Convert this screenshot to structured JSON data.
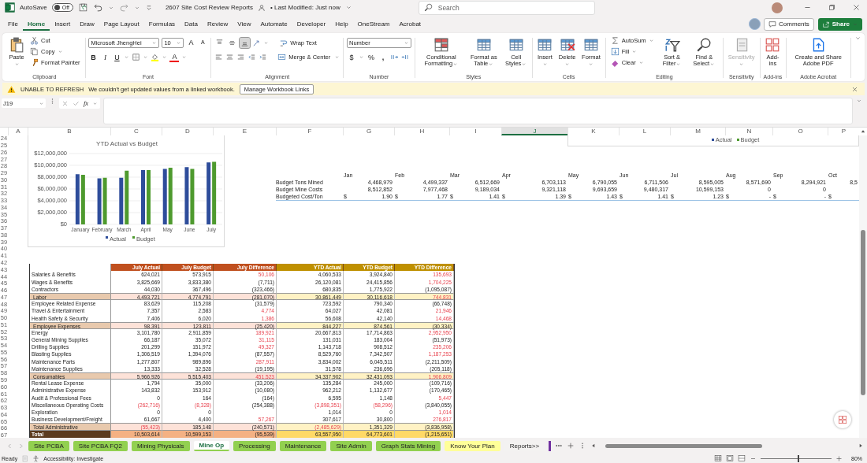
{
  "titlebar": {
    "autosave_label": "AutoSave",
    "autosave": {
      "on": false,
      "label": "Off"
    },
    "doc_title": "2607 Site Cost Review Reports",
    "modified": "• Last Modified: Just now",
    "search_placeholder": "Search"
  },
  "menu": [
    {
      "label": "File",
      "selected": false
    },
    {
      "label": "Home",
      "selected": true
    },
    {
      "label": "Insert",
      "selected": false
    },
    {
      "label": "Draw",
      "selected": false
    },
    {
      "label": "Page Layout",
      "selected": false
    },
    {
      "label": "Formulas",
      "selected": false
    },
    {
      "label": "Data",
      "selected": false
    },
    {
      "label": "Review",
      "selected": false
    },
    {
      "label": "View",
      "selected": false
    },
    {
      "label": "Automate",
      "selected": false
    },
    {
      "label": "Developer",
      "selected": false
    },
    {
      "label": "Help",
      "selected": false
    },
    {
      "label": "OneStream",
      "selected": false
    },
    {
      "label": "Acrobat",
      "selected": false
    }
  ],
  "actions": {
    "comments": "Comments",
    "share": "Share"
  },
  "ribbon": [
    {
      "kind": "standard",
      "label": "Clipboard",
      "items": [
        {
          "kind": "paste",
          "label": "Paste",
          "menu": true,
          "disabled": false
        },
        {
          "kind": "cut",
          "label": "Cut",
          "menu": false,
          "disabled": false
        },
        {
          "kind": "copy",
          "label": "Copy",
          "menu": true,
          "disabled": false
        },
        {
          "kind": "painter",
          "label": "Format Painter",
          "menu": false,
          "disabled": false
        }
      ]
    },
    {
      "kind": "font",
      "label": "Font",
      "font_name": "Microsoft JhengHei",
      "font_size": "10",
      "grow": "A",
      "shrink": "A",
      "bold": "B",
      "italic": "I",
      "underline": "U",
      "font_color": "A"
    },
    {
      "kind": "alignment",
      "label": "Alignment",
      "valign": [
        {
          "selected": false
        },
        {
          "selected": false
        },
        {
          "selected": true
        }
      ],
      "wrap": "Wrap Text",
      "merge": "Merge & Center"
    },
    {
      "kind": "number",
      "label": "Number",
      "format": "Number",
      "currency": "$",
      "percent": "%",
      "comma": ","
    },
    {
      "kind": "standard",
      "label": "Styles",
      "items": [
        {
          "kind": "cond_format",
          "label": "Conditional Formatting",
          "menu": true,
          "disabled": false
        },
        {
          "kind": "format_table",
          "label": "Format as Table",
          "menu": true,
          "disabled": false
        },
        {
          "kind": "cell_styles",
          "label": "Cell Styles",
          "menu": true,
          "disabled": false
        }
      ]
    },
    {
      "kind": "standard",
      "label": "Cells",
      "items": [
        {
          "kind": "insert",
          "label": "Insert",
          "menu": true,
          "disabled": false
        },
        {
          "kind": "delete",
          "label": "Delete",
          "menu": true,
          "disabled": false
        },
        {
          "kind": "format",
          "label": "Format",
          "menu": true,
          "disabled": false
        }
      ]
    },
    {
      "kind": "standard",
      "label": "Editing",
      "items": [
        {
          "kind": "autosum",
          "label": "AutoSum",
          "menu": true,
          "disabled": false
        },
        {
          "kind": "fill",
          "label": "Fill",
          "menu": true,
          "disabled": false
        },
        {
          "kind": "clear",
          "label": "Clear",
          "menu": true,
          "disabled": false
        },
        {
          "kind": "sort",
          "label": "Sort & Filter",
          "menu": true,
          "disabled": false
        },
        {
          "kind": "find",
          "label": "Find & Select",
          "menu": true,
          "disabled": false
        }
      ]
    },
    {
      "kind": "standard",
      "label": "Sensitivity",
      "items": [
        {
          "kind": "sensitivity",
          "label": "Sensitivity",
          "menu": true,
          "disabled": true
        }
      ]
    },
    {
      "kind": "standard",
      "label": "Add-ins",
      "items": [
        {
          "kind": "addins",
          "label": "Add-ins",
          "menu": false,
          "disabled": false
        }
      ]
    },
    {
      "kind": "standard",
      "label": "Adobe Acrobat",
      "items": [
        {
          "kind": "pdf",
          "label": "Create and Share Adobe PDF",
          "menu": false,
          "disabled": false
        }
      ]
    }
  ],
  "warning": {
    "title": "UNABLE TO REFRESH",
    "message": "We couldn't get updated values from a linked workbook.",
    "button": "Manage Workbook Links"
  },
  "formula_bar": {
    "cell_ref": "J19",
    "fx": "fx"
  },
  "columns": [
    {
      "label": "A",
      "selected": false
    },
    {
      "label": "B",
      "selected": false
    },
    {
      "label": "C",
      "selected": false
    },
    {
      "label": "D",
      "selected": false
    },
    {
      "label": "E",
      "selected": false
    },
    {
      "label": "F",
      "selected": false
    },
    {
      "label": "G",
      "selected": false
    },
    {
      "label": "H",
      "selected": false
    },
    {
      "label": "I",
      "selected": false
    },
    {
      "label": "J",
      "selected": true
    },
    {
      "label": "K",
      "selected": false
    },
    {
      "label": "L",
      "selected": false
    },
    {
      "label": "M",
      "selected": false
    },
    {
      "label": "N",
      "selected": false
    },
    {
      "label": "O",
      "selected": false
    },
    {
      "label": "P",
      "selected": false
    }
  ],
  "row_numbers": [
    "24",
    "25",
    "26",
    "27",
    "28",
    "29",
    "30",
    "31",
    "32",
    "33",
    "34",
    "35",
    "36",
    "37",
    "38",
    "39",
    "40",
    "41",
    "42",
    "43",
    "44",
    "45",
    "46",
    "47",
    "48",
    "49",
    "50",
    "51",
    "52",
    "53",
    "54",
    "55",
    "56",
    "57",
    "58",
    "59",
    "60",
    "61",
    "62",
    "63",
    "64",
    "65",
    "66",
    "67"
  ],
  "chart": {
    "chart_data": {
      "type": "bar",
      "title": "YTD Actual vs Budget",
      "categories": [
        "January",
        "February",
        "March",
        "April",
        "May",
        "June",
        "July"
      ],
      "series": [
        {
          "name": "Actual",
          "color": "#2e4d9b",
          "values": [
            8500000,
            7800000,
            7900000,
            9200000,
            9400000,
            9700000,
            10500000
          ]
        },
        {
          "name": "Budget",
          "color": "#4e9a2e",
          "values": [
            8400000,
            7900000,
            9100000,
            9200000,
            9600000,
            9400000,
            10600000
          ]
        }
      ],
      "ylim": [
        0,
        12000000
      ],
      "yticks": [
        {
          "value": 0,
          "label": "$0"
        },
        {
          "value": 2000000,
          "label": "$2,000,000"
        },
        {
          "value": 4000000,
          "label": "$4,000,000"
        },
        {
          "value": 6000000,
          "label": "$6,000,000"
        },
        {
          "value": 8000000,
          "label": "$8,000,000"
        },
        {
          "value": 10000000,
          "label": "$10,000,000"
        },
        {
          "value": 12000000,
          "label": "$12,000,000"
        }
      ],
      "grid": true,
      "legend": "bottom"
    }
  },
  "second_chart": {
    "legend": [
      {
        "label": "Actual",
        "color": "#2e4d9b"
      },
      {
        "label": "Budget",
        "color": "#4e9a2e"
      }
    ]
  },
  "budget_table": {
    "months": [
      "Jan",
      "Feb",
      "Mar",
      "Apr",
      "May",
      "Jun",
      "Jul",
      "Aug",
      "Sep",
      "Oct"
    ],
    "rows": [
      {
        "label": "Budget Tons Mined",
        "kind": "number",
        "values": [
          "4,468,979",
          "4,499,337",
          "6,512,669",
          "6,703,113",
          "6,790,055",
          "6,711,506",
          "8,595,005",
          "8,571,690",
          "8,294,921",
          "8,5"
        ]
      },
      {
        "label": "Budget Mine Costs",
        "kind": "number",
        "values": [
          "8,512,852",
          "7,977,468",
          "9,189,034",
          "9,321,118",
          "9,693,659",
          "9,480,317",
          "10,599,153",
          "0",
          "0"
        ]
      },
      {
        "label": "Budgeted Cost/Ton",
        "kind": "currency",
        "values": [
          {
            "sym": "$",
            "v": "1.90"
          },
          {
            "sym": "$",
            "v": "1.77"
          },
          {
            "sym": "$",
            "v": "1.41"
          },
          {
            "sym": "$",
            "v": "1.39"
          },
          {
            "sym": "$",
            "v": "1.43"
          },
          {
            "sym": "$",
            "v": "1.41"
          },
          {
            "sym": "$",
            "v": "1.23"
          },
          {
            "sym": "$",
            "v": "-"
          },
          {
            "sym": "$",
            "v": "-"
          },
          {
            "sym": "$"
          }
        ]
      }
    ]
  },
  "cost_table": {
    "columns": [
      {
        "label": "July Actual",
        "kind": "july"
      },
      {
        "label": "July Budget",
        "kind": "july"
      },
      {
        "label": "July Difference",
        "kind": "july"
      },
      {
        "label": "YTD Actual",
        "kind": "ytd"
      },
      {
        "label": "YTD Budget",
        "kind": "ytd"
      },
      {
        "label": "YTD Difference",
        "kind": "ytd"
      }
    ],
    "rows": [
      {
        "label": "Salaries & Benefits",
        "kind": "line",
        "cells": [
          {
            "v": "624,021",
            "red": false
          },
          {
            "v": "573,915",
            "red": false
          },
          {
            "v": "50,106",
            "red": true
          },
          {
            "v": "4,060,533",
            "red": false
          },
          {
            "v": "3,924,840",
            "red": false
          },
          {
            "v": "135,693",
            "red": true
          }
        ]
      },
      {
        "label": "Wages & Benefits",
        "kind": "line",
        "cells": [
          {
            "v": "3,825,669",
            "red": false
          },
          {
            "v": "3,833,380",
            "red": false
          },
          {
            "v": "(7,711)",
            "red": false
          },
          {
            "v": "26,120,081",
            "red": false
          },
          {
            "v": "24,415,856",
            "red": false
          },
          {
            "v": "1,704,225",
            "red": true
          }
        ]
      },
      {
        "label": "Contractors",
        "kind": "line",
        "cells": [
          {
            "v": "44,030",
            "red": false
          },
          {
            "v": "367,496",
            "red": false
          },
          {
            "v": "(323,466)",
            "red": false
          },
          {
            "v": "680,835",
            "red": false
          },
          {
            "v": "1,775,922",
            "red": false
          },
          {
            "v": "(1,095,087)",
            "red": false
          }
        ]
      },
      {
        "label": "Labor",
        "kind": "subtotal",
        "cells": [
          {
            "v": "4,493,721",
            "red": false
          },
          {
            "v": "4,774,791",
            "red": false
          },
          {
            "v": "(281,070)",
            "red": false
          },
          {
            "v": "30,861,449",
            "red": false
          },
          {
            "v": "30,116,618",
            "red": false
          },
          {
            "v": "744,831",
            "red": true
          }
        ]
      },
      {
        "label": "Employee Related Expense",
        "kind": "line",
        "cells": [
          {
            "v": "83,629",
            "red": false
          },
          {
            "v": "115,208",
            "red": false
          },
          {
            "v": "(31,579)",
            "red": false
          },
          {
            "v": "723,592",
            "red": false
          },
          {
            "v": "790,340",
            "red": false
          },
          {
            "v": "(66,748)",
            "red": false
          }
        ]
      },
      {
        "label": "Travel & Entertainment",
        "kind": "line",
        "cells": [
          {
            "v": "7,357",
            "red": false
          },
          {
            "v": "2,583",
            "red": false
          },
          {
            "v": "4,774",
            "red": true
          },
          {
            "v": "64,027",
            "red": false
          },
          {
            "v": "42,081",
            "red": false
          },
          {
            "v": "21,946",
            "red": true
          }
        ]
      },
      {
        "label": "Health Safety & Security",
        "kind": "line",
        "cells": [
          {
            "v": "7,406",
            "red": false
          },
          {
            "v": "6,020",
            "red": false
          },
          {
            "v": "1,386",
            "red": true
          },
          {
            "v": "56,608",
            "red": false
          },
          {
            "v": "42,140",
            "red": false
          },
          {
            "v": "14,468",
            "red": true
          }
        ]
      },
      {
        "label": "Employee Expenses",
        "kind": "subtotal",
        "cells": [
          {
            "v": "98,391",
            "red": false
          },
          {
            "v": "123,811",
            "red": false
          },
          {
            "v": "(25,420)",
            "red": false
          },
          {
            "v": "844,227",
            "red": false
          },
          {
            "v": "874,561",
            "red": false
          },
          {
            "v": "(30,334)",
            "red": false
          }
        ]
      },
      {
        "label": "Energy",
        "kind": "line",
        "cells": [
          {
            "v": "3,101,780",
            "red": false
          },
          {
            "v": "2,911,859",
            "red": false
          },
          {
            "v": "189,921",
            "red": true
          },
          {
            "v": "20,667,813",
            "red": false
          },
          {
            "v": "17,714,863",
            "red": false
          },
          {
            "v": "2,952,950",
            "red": true
          }
        ]
      },
      {
        "label": "General Mining Supplies",
        "kind": "line",
        "cells": [
          {
            "v": "66,187",
            "red": false
          },
          {
            "v": "35,072",
            "red": false
          },
          {
            "v": "31,115",
            "red": true
          },
          {
            "v": "131,031",
            "red": false
          },
          {
            "v": "183,004",
            "red": false
          },
          {
            "v": "(51,973)",
            "red": false
          }
        ]
      },
      {
        "label": "Drilling Supplies",
        "kind": "line",
        "cells": [
          {
            "v": "201,299",
            "red": false
          },
          {
            "v": "151,972",
            "red": false
          },
          {
            "v": "49,327",
            "red": true
          },
          {
            "v": "1,143,718",
            "red": false
          },
          {
            "v": "908,512",
            "red": false
          },
          {
            "v": "235,206",
            "red": true
          }
        ]
      },
      {
        "label": "Blasting Supplies",
        "kind": "line",
        "cells": [
          {
            "v": "1,306,519",
            "red": false
          },
          {
            "v": "1,394,076",
            "red": false
          },
          {
            "v": "(87,557)",
            "red": false
          },
          {
            "v": "8,529,760",
            "red": false
          },
          {
            "v": "7,342,507",
            "red": false
          },
          {
            "v": "1,187,253",
            "red": true
          }
        ]
      },
      {
        "label": "Maintenance Parts",
        "kind": "line",
        "cells": [
          {
            "v": "1,277,807",
            "red": false
          },
          {
            "v": "989,896",
            "red": false
          },
          {
            "v": "287,911",
            "red": true
          },
          {
            "v": "3,834,002",
            "red": false
          },
          {
            "v": "6,045,511",
            "red": false
          },
          {
            "v": "(2,211,509)",
            "red": false
          }
        ]
      },
      {
        "label": "Maintenance Supplies",
        "kind": "line",
        "cells": [
          {
            "v": "13,333",
            "red": false
          },
          {
            "v": "32,528",
            "red": false
          },
          {
            "v": "(19,195)",
            "red": false
          },
          {
            "v": "31,578",
            "red": false
          },
          {
            "v": "236,696",
            "red": false
          },
          {
            "v": "(205,118)",
            "red": false
          }
        ]
      },
      {
        "label": "Consumables",
        "kind": "subtotal",
        "cells": [
          {
            "v": "5,966,926",
            "red": false
          },
          {
            "v": "5,515,403",
            "red": false
          },
          {
            "v": "451,523",
            "red": true
          },
          {
            "v": "34,337,902",
            "red": false
          },
          {
            "v": "32,431,093",
            "red": false
          },
          {
            "v": "1,906,809",
            "red": true
          }
        ]
      },
      {
        "label": "Rental Lease Expense",
        "kind": "line",
        "cells": [
          {
            "v": "1,794",
            "red": false
          },
          {
            "v": "35,000",
            "red": false
          },
          {
            "v": "(33,206)",
            "red": false
          },
          {
            "v": "135,284",
            "red": false
          },
          {
            "v": "245,000",
            "red": false
          },
          {
            "v": "(109,716)",
            "red": false
          }
        ]
      },
      {
        "label": "Administrative Expense",
        "kind": "line",
        "cells": [
          {
            "v": "143,832",
            "red": false
          },
          {
            "v": "153,912",
            "red": false
          },
          {
            "v": "(10,080)",
            "red": false
          },
          {
            "v": "962,212",
            "red": false
          },
          {
            "v": "1,132,677",
            "red": false
          },
          {
            "v": "(170,465)",
            "red": false
          }
        ]
      },
      {
        "label": "Audit & Professional Fees",
        "kind": "line",
        "cells": [
          {
            "v": "0",
            "red": false
          },
          {
            "v": "164",
            "red": false
          },
          {
            "v": "(164)",
            "red": false
          },
          {
            "v": "6,595",
            "red": false
          },
          {
            "v": "1,148",
            "red": false
          },
          {
            "v": "5,447",
            "red": true
          }
        ]
      },
      {
        "label": "Miscellaneous Operating Costs",
        "kind": "line",
        "cells": [
          {
            "v": "(262,716)",
            "red": true
          },
          {
            "v": "(8,328)",
            "red": true
          },
          {
            "v": "(254,388)",
            "red": false
          },
          {
            "v": "(3,898,351)",
            "red": true
          },
          {
            "v": "(58,296)",
            "red": true
          },
          {
            "v": "(3,840,055)",
            "red": false
          }
        ]
      },
      {
        "label": "Exploration",
        "kind": "line",
        "cells": [
          {
            "v": "0",
            "red": false
          },
          {
            "v": "0",
            "red": false
          },
          {},
          {
            "v": "1,014",
            "red": false
          },
          {
            "v": "0",
            "red": false
          },
          {
            "v": "1,014",
            "red": true
          }
        ]
      },
      {
        "label": "Business Development/Freight",
        "kind": "line",
        "cells": [
          {
            "v": "61,667",
            "red": false
          },
          {
            "v": "4,400",
            "red": false
          },
          {
            "v": "57,267",
            "red": true
          },
          {
            "v": "307,617",
            "red": false
          },
          {
            "v": "30,800",
            "red": false
          },
          {
            "v": "276,817",
            "red": true
          }
        ]
      },
      {
        "label": "Total Administrative",
        "kind": "subtotal",
        "cells": [
          {
            "v": "(55,423)",
            "red": true
          },
          {
            "v": "185,148",
            "red": false
          },
          {
            "v": "(240,571)",
            "red": false
          },
          {
            "v": "(2,485,629)",
            "red": true
          },
          {
            "v": "1,351,329",
            "red": false
          },
          {
            "v": "(3,836,958)",
            "red": false
          }
        ]
      },
      {
        "label": "Total",
        "kind": "total",
        "cells": [
          {
            "v": "10,503,614",
            "red": false
          },
          {
            "v": "10,599,153",
            "red": false
          },
          {
            "v": "(95,539)",
            "red": false
          },
          {
            "v": "63,557,950",
            "red": false
          },
          {
            "v": "64,773,601",
            "red": false
          },
          {
            "v": "(1,215,651)",
            "red": false
          }
        ]
      }
    ]
  },
  "sheet_tabs": [
    {
      "label": "Site PCBA",
      "color": "#92d050",
      "selected": false
    },
    {
      "label": "Site PCBA FQ2",
      "color": "#92d050",
      "selected": false
    },
    {
      "label": "Mining Physicals",
      "color": "#92d050",
      "selected": false
    },
    {
      "label": "Mine Op",
      "color": "#92d050",
      "selected": true
    },
    {
      "label": "Processing",
      "color": "#92d050",
      "selected": false
    },
    {
      "label": "Maintenance",
      "color": "#92d050",
      "selected": false
    },
    {
      "label": "Site Admin",
      "color": "#92d050",
      "selected": false
    },
    {
      "label": "Graph Stats Mining",
      "color": "#92d050",
      "selected": false
    },
    {
      "label": "Know Your Plan",
      "color": "#ffff99",
      "selected": false
    },
    {
      "label": "Reports>>",
      "color": "#f3f2f1",
      "selected": false
    }
  ],
  "status": {
    "ready": "Ready",
    "accessibility": "Accessibility: Investigate",
    "zoom": {
      "level": 0.52,
      "label": "80%"
    }
  }
}
